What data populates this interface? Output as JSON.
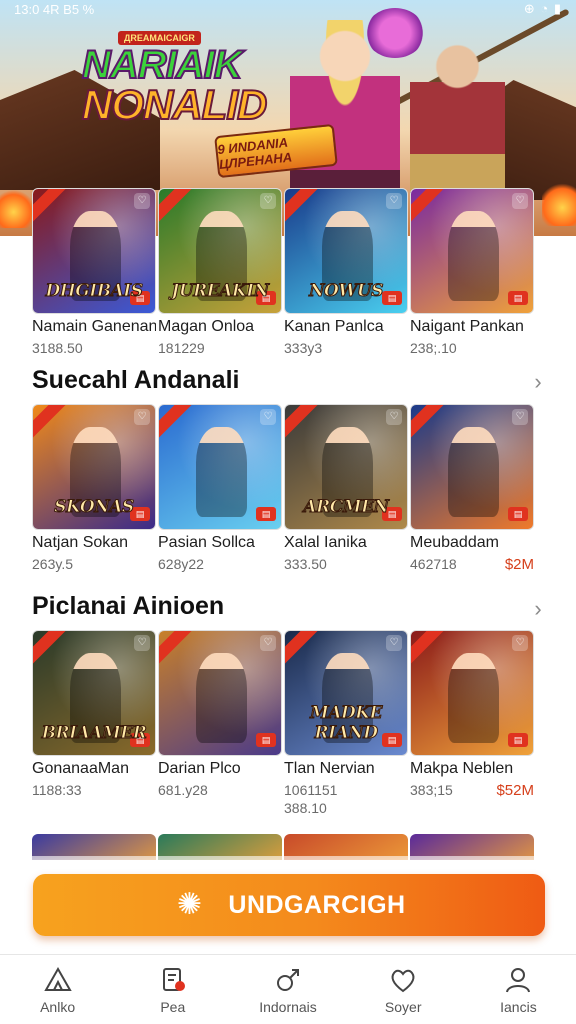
{
  "status_bar": {
    "time": "13:0 4R B5 %",
    "icons": "⊕ ◔ ▮"
  },
  "banner": {
    "tag": "ДREAMAICAIGR",
    "title_line1": "NARIAIK",
    "title_line2": "NONALID",
    "event_badge": "9 ИNDANIA ЦЛРЕНАНА"
  },
  "rows": [
    {
      "games": [
        {
          "art": "DHGIBAIS",
          "name": "Namain Ganenan",
          "meta": "3188.50",
          "colors": [
            "#8a1a1a",
            "#3a5ad8"
          ]
        },
        {
          "art": "JUREAKIN",
          "name": "Magan Onloa",
          "meta": "181229",
          "colors": [
            "#2a7a2a",
            "#c8a23a"
          ]
        },
        {
          "art": "NOWUS",
          "name": "Kanan Panlca",
          "meta": "333y3",
          "colors": [
            "#1a3a8a",
            "#4ad0f0"
          ]
        },
        {
          "art": "",
          "name": "Naigant Pankan",
          "meta": "238;.10",
          "colors": [
            "#7a2aa0",
            "#f0a23a"
          ]
        }
      ]
    },
    {
      "title": "Suecahl Andanali",
      "games": [
        {
          "art": "SKONAS",
          "name": "Natjan Sokan",
          "meta": "263y.5",
          "price": "",
          "colors": [
            "#f08a1a",
            "#3a2a8a"
          ]
        },
        {
          "art": "",
          "name": "Pasian Sollca",
          "meta": "628y22",
          "price": "",
          "colors": [
            "#2a6ad0",
            "#6ad0f0"
          ]
        },
        {
          "art": "ARCMEN",
          "name": "Xalal Ianika",
          "meta": "333.50",
          "price": "",
          "colors": [
            "#3a3a3a",
            "#b08a4a"
          ]
        },
        {
          "art": "",
          "name": "Meubaddam",
          "meta": "462718",
          "price": "$2M",
          "colors": [
            "#1a3a8a",
            "#f07a2a"
          ]
        }
      ]
    },
    {
      "title": "Piclanai Ainioen",
      "games": [
        {
          "art": "BRIAAMER",
          "name": "GonanaaMan",
          "meta": "1188:33",
          "meta2": "",
          "price": "",
          "colors": [
            "#2a3a2a",
            "#8a6a2a"
          ]
        },
        {
          "art": "",
          "name": "Darian Plco",
          "meta": "681.y28",
          "meta2": "",
          "price": "",
          "colors": [
            "#c8802a",
            "#4a3a8a"
          ]
        },
        {
          "art": "MADKE RIAND",
          "name": "Tlan Nervian",
          "meta": "1061151",
          "meta2": "388.10",
          "price": "",
          "colors": [
            "#1a2a4a",
            "#6a8ad0"
          ]
        },
        {
          "art": "",
          "name": "Makpa Neblen",
          "meta": "383;15",
          "meta2": "",
          "price": "$52M",
          "colors": [
            "#8a1a1a",
            "#f0a23a"
          ]
        }
      ]
    }
  ],
  "partial_colors": [
    "#3a3aa0",
    "#2a7a5a",
    "#c84a2a",
    "#5a2a9a"
  ],
  "cta": {
    "label": "UNDGARCIGH",
    "icon": "gear-icon"
  },
  "nav": [
    {
      "label": "Anlko",
      "icon": "triangle-icon"
    },
    {
      "label": "Pea",
      "icon": "document-icon"
    },
    {
      "label": "Indornais",
      "icon": "male-icon"
    },
    {
      "label": "Soyer",
      "icon": "heart-icon"
    },
    {
      "label": "Iancis",
      "icon": "user-icon"
    }
  ],
  "accent_color": "#f48a1c",
  "price_color": "#d6401c"
}
